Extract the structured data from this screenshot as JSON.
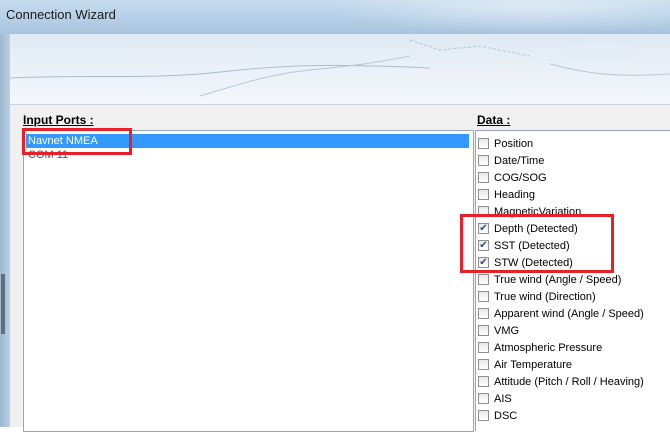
{
  "window": {
    "title": "Connection Wizard"
  },
  "input_ports": {
    "label": "Input Ports :",
    "items": [
      {
        "label": "Navnet NMEA",
        "selected": true
      },
      {
        "label": "COM 11",
        "selected": false
      }
    ]
  },
  "data_panel": {
    "label": "Data :",
    "items": [
      {
        "label": "Position",
        "checked": false
      },
      {
        "label": "Date/Time",
        "checked": false
      },
      {
        "label": "COG/SOG",
        "checked": false
      },
      {
        "label": "Heading",
        "checked": false
      },
      {
        "label": "MagneticVariation",
        "checked": false
      },
      {
        "label": "Depth (Detected)",
        "checked": true
      },
      {
        "label": "SST (Detected)",
        "checked": true
      },
      {
        "label": "STW (Detected)",
        "checked": true
      },
      {
        "label": "True wind (Angle / Speed)",
        "checked": false
      },
      {
        "label": "True wind (Direction)",
        "checked": false
      },
      {
        "label": "Apparent wind (Angle / Speed)",
        "checked": false
      },
      {
        "label": "VMG",
        "checked": false
      },
      {
        "label": "Atmospheric Pressure",
        "checked": false
      },
      {
        "label": "Air Temperature",
        "checked": false
      },
      {
        "label": "Attitude (Pitch / Roll / Heaving)",
        "checked": false
      },
      {
        "label": "AIS",
        "checked": false
      },
      {
        "label": "DSC",
        "checked": false
      }
    ]
  },
  "colors": {
    "highlight": "#e8202a",
    "selection": "#3399ff"
  }
}
